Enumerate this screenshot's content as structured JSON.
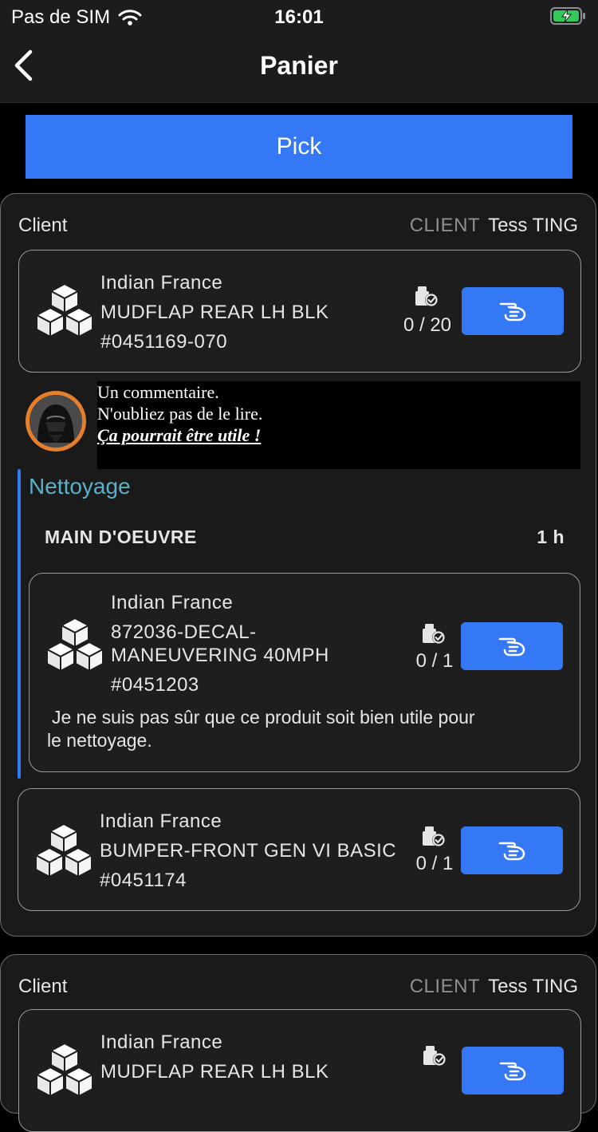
{
  "status_bar": {
    "carrier": "Pas de SIM",
    "time": "16:01"
  },
  "nav": {
    "title": "Panier"
  },
  "pick_button": {
    "label": "Pick"
  },
  "groups": [
    {
      "label": "Client",
      "client_key": "CLIENT",
      "client_name": "Tess TING",
      "items": [
        {
          "brand": "Indian France",
          "name": "MUDFLAP REAR LH BLK",
          "ref": "#0451169-070",
          "count": "0 / 20"
        }
      ],
      "comment": {
        "line1": "Un commentaire.",
        "line2": "N'oubliez pas de le lire.",
        "line3": "Ça pourrait être utile !"
      },
      "section": {
        "title": "Nettoyage",
        "row_label": "MAIN D'OEUVRE",
        "row_value": "1 h",
        "item": {
          "brand": "Indian France",
          "name_line1": "872036-DECAL-",
          "name_line2": "MANEUVERING 40MPH",
          "ref": "#0451203",
          "count": "0 / 1",
          "note_line1": "Je ne suis pas sûr que ce produit soit bien utile pour",
          "note_line2": "le nettoyage."
        }
      },
      "item_after": {
        "brand": "Indian France",
        "name": "BUMPER-FRONT GEN VI BASIC",
        "ref": "#0451174",
        "count": "0 / 1"
      }
    },
    {
      "label": "Client",
      "client_key": "CLIENT",
      "client_name": "Tess TING",
      "items": [
        {
          "brand": "Indian France",
          "name": "MUDFLAP REAR LH BLK"
        }
      ]
    }
  ],
  "icons": {
    "product": "cubes-icon",
    "stock": "stock-check-icon",
    "pick": "hand-pick-icon",
    "back": "chevron-left-icon"
  },
  "colors": {
    "accent": "#3478f6",
    "section_title": "#5ab0c8",
    "avatar_ring": "#e57f2a"
  }
}
